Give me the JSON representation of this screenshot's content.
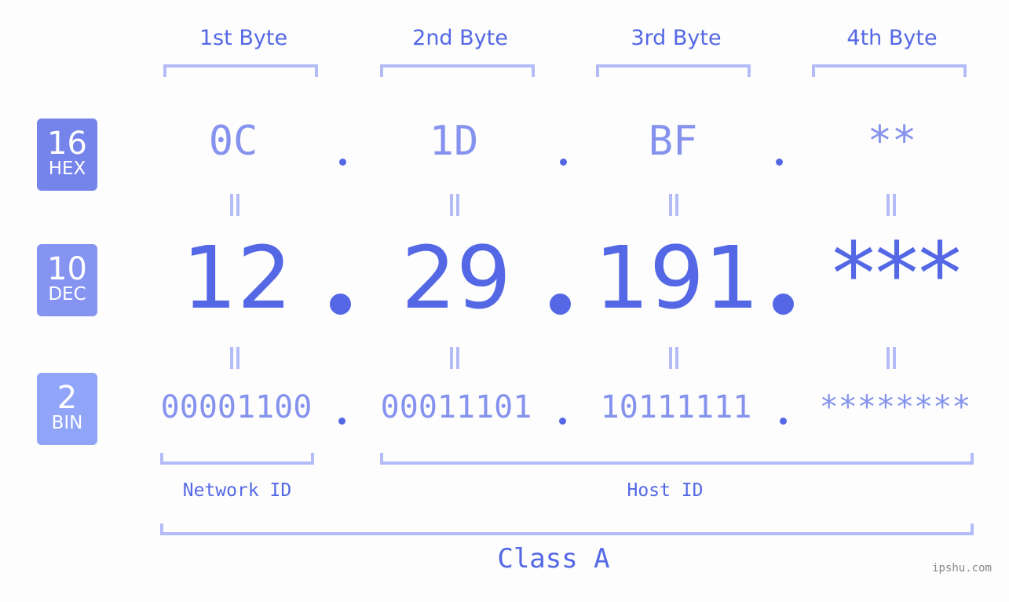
{
  "byte_headers": [
    "1st Byte",
    "2nd Byte",
    "3rd Byte",
    "4th Byte"
  ],
  "badges": {
    "hex": {
      "num": "16",
      "label": "HEX",
      "color": "#7584ea"
    },
    "dec": {
      "num": "10",
      "label": "DEC",
      "color": "#8593f1"
    },
    "bin": {
      "num": "2",
      "label": "BIN",
      "color": "#90a4f8"
    }
  },
  "hex_values": [
    "0C",
    "1D",
    "BF",
    "**"
  ],
  "dec_values": [
    "12",
    "29",
    "191",
    "***"
  ],
  "bin_values": [
    "00001100",
    "00011101",
    "10111111",
    "********"
  ],
  "network_label": "Network ID",
  "host_label": "Host ID",
  "class_label": "Class A",
  "watermark": "ipshu.com",
  "colors": {
    "primary": "#5468e6",
    "secondary": "#8592ee",
    "bracket": "#b3bcf7"
  }
}
